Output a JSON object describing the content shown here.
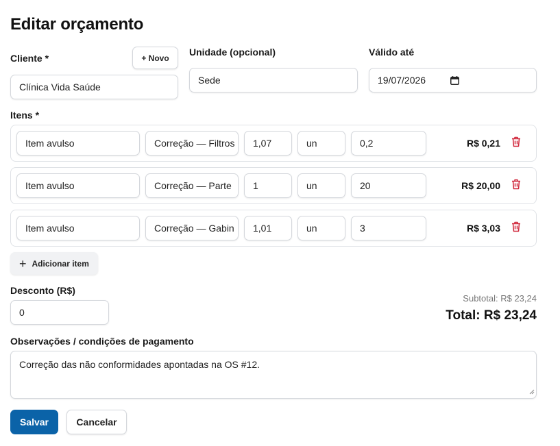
{
  "page": {
    "title": "Editar orçamento"
  },
  "cliente": {
    "label": "Cliente *",
    "value": "Clínica Vida Saúde",
    "novo_label": "+ Novo"
  },
  "unidade": {
    "label": "Unidade (opcional)",
    "value": "Sede"
  },
  "validade": {
    "label": "Válido até",
    "value": "19/07/2026",
    "icon": "calendar-icon"
  },
  "itens": {
    "label": "Itens *",
    "rows": [
      {
        "tipo": "Item avulso",
        "descricao": "Correção — Filtros",
        "quantidade": "1,07",
        "unidade": "un",
        "preco": "0,2",
        "total": "R$ 0,21"
      },
      {
        "tipo": "Item avulso",
        "descricao": "Correção — Parte",
        "quantidade": "1",
        "unidade": "un",
        "preco": "20",
        "total": "R$ 20,00"
      },
      {
        "tipo": "Item avulso",
        "descricao": "Correção — Gabin",
        "quantidade": "1,01",
        "unidade": "un",
        "preco": "3",
        "total": "R$ 3,03"
      }
    ],
    "add_label": "Adicionar item"
  },
  "desconto": {
    "label": "Desconto (R$)",
    "value": "0"
  },
  "totais": {
    "subtotal": "Subtotal: R$ 23,24",
    "total": "Total: R$ 23,24"
  },
  "observacoes": {
    "label": "Observações / condições de pagamento",
    "value": "Correção das não conformidades apontadas na OS #12."
  },
  "actions": {
    "save_label": "Salvar",
    "cancel_label": "Cancelar"
  },
  "colors": {
    "primary": "#0b63a8",
    "danger": "#d0263a"
  }
}
